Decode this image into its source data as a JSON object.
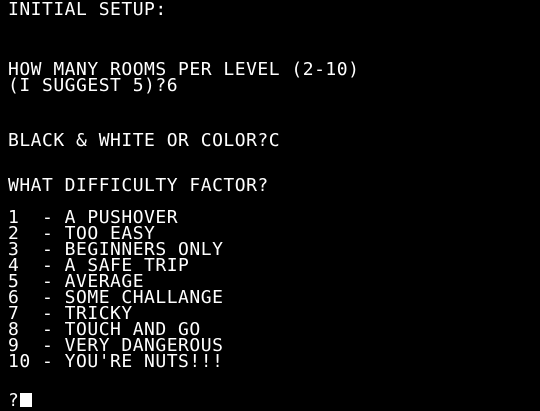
{
  "screen": {
    "title": "INITIAL SETUP:",
    "rooms_question_line1": "HOW MANY ROOMS PER LEVEL (2-10)",
    "rooms_question_line2": "(I SUGGEST 5)?6",
    "color_question": "BLACK & WHITE OR COLOR?C",
    "difficulty_question": "WHAT DIFFICULTY FACTOR?",
    "difficulty_options": [
      "1  - A PUSHOVER",
      "2  - TOO EASY",
      "3  - BEGINNERS ONLY",
      "4  - A SAFE TRIP",
      "5  - AVERAGE",
      "6  - SOME CHALLANGE",
      "7  - TRICKY",
      "8  - TOUCH AND GO",
      "9  - VERY DANGEROUS",
      "10 - YOU'RE NUTS!!!"
    ],
    "prompt": "?"
  },
  "colors": {
    "background": "#000000",
    "foreground": "#ffffff"
  }
}
